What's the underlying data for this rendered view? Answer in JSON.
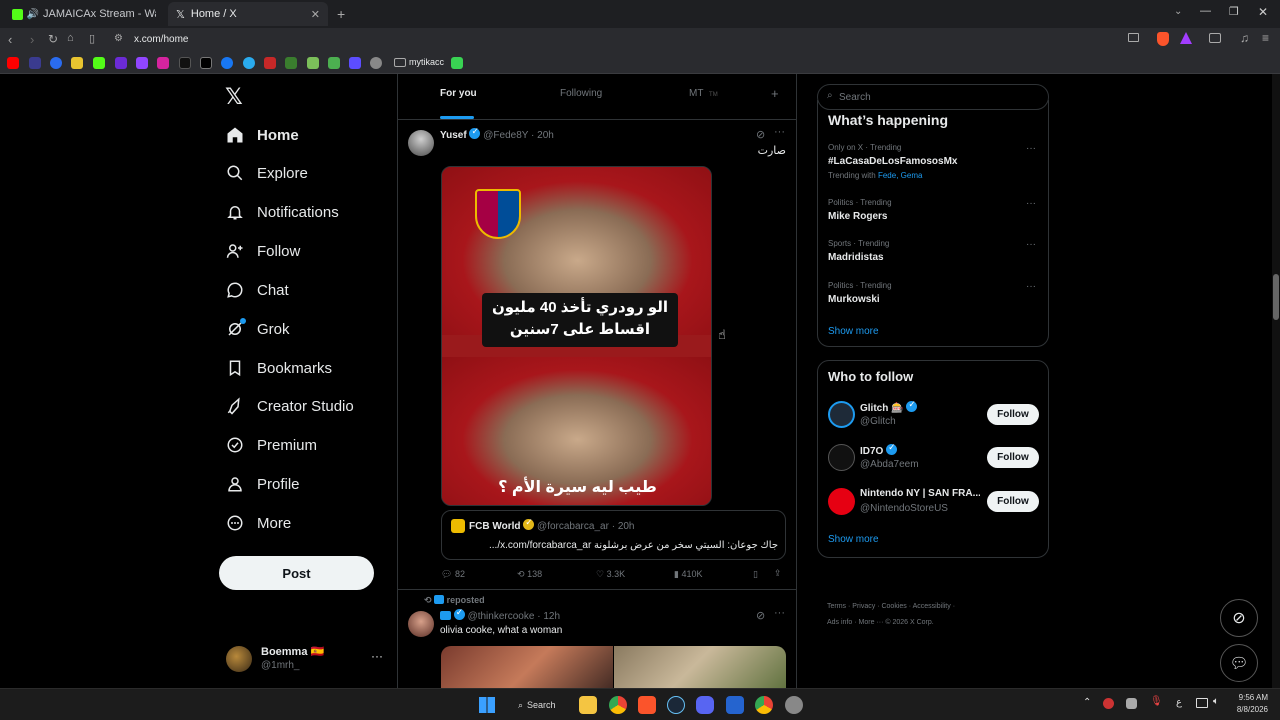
{
  "browser": {
    "tabs": [
      {
        "title": "JAMAICAx Stream - Watch Live o",
        "active": false
      },
      {
        "title": "Home / X",
        "active": true
      }
    ],
    "url": "x.com/home",
    "bookmark_folder": "mytikacc"
  },
  "sidebar": {
    "items": [
      {
        "label": "Home",
        "icon": "home-icon"
      },
      {
        "label": "Explore",
        "icon": "search-icon"
      },
      {
        "label": "Notifications",
        "icon": "bell-icon"
      },
      {
        "label": "Follow",
        "icon": "person-add-icon"
      },
      {
        "label": "Chat",
        "icon": "chat-icon"
      },
      {
        "label": "Grok",
        "icon": "grok-icon"
      },
      {
        "label": "Bookmarks",
        "icon": "bookmark-icon"
      },
      {
        "label": "Creator Studio",
        "icon": "rocket-icon"
      },
      {
        "label": "Premium",
        "icon": "premium-icon"
      },
      {
        "label": "Profile",
        "icon": "profile-icon"
      },
      {
        "label": "More",
        "icon": "more-circle-icon"
      }
    ],
    "post_button": "Post",
    "account": {
      "name": "Boemma 🇪🇸",
      "handle": "@1mrh_"
    }
  },
  "feed": {
    "tabs": [
      {
        "label": "For you",
        "active": true
      },
      {
        "label": "Following",
        "active": false
      },
      {
        "label": "MT",
        "active": false
      }
    ],
    "tab_badge": "TM",
    "post1": {
      "name": "Yusef",
      "handle": "@Fede8Y",
      "time": "20h",
      "text": "صارت",
      "image_text_top_1": "الو رودري تأخذ 40 مليون",
      "image_text_top_2": "اقساط على 7سنين",
      "image_text_bottom": "طيب ليه سيرة الأم ؟",
      "quote": {
        "name": "FCB World",
        "handle": "@forcabarca_ar",
        "time": "20h",
        "text": "جاك جوعان: السيتي سخر من عرض برشلونة x.com/forcabarca_ar/..."
      },
      "stats": {
        "replies": "82",
        "reposts": "138",
        "likes": "3.3K",
        "views": "410K"
      }
    },
    "post2": {
      "reposted_label": "reposted",
      "handle": "@thinkercooke",
      "time": "12h",
      "text": "olivia cooke, what a woman"
    }
  },
  "right": {
    "search_placeholder": "Search",
    "whats_happening": "What’s happening",
    "trends": [
      {
        "meta": "Only on X · Trending",
        "name": "#LaCasaDeLosFamososMx",
        "extra_label": "Trending with",
        "extra_links": "Fede, Gema"
      },
      {
        "meta": "Politics · Trending",
        "name": "Mike Rogers"
      },
      {
        "meta": "Sports · Trending",
        "name": "Madridistas"
      },
      {
        "meta": "Politics · Trending",
        "name": "Murkowski"
      }
    ],
    "show_more": "Show more",
    "who_to_follow": "Who to follow",
    "follow_suggestions": [
      {
        "name": "Glitch 🎰",
        "handle": "@Glitch",
        "button": "Follow",
        "color": "#1d9bf0"
      },
      {
        "name": "ID7O",
        "handle": "@Abda7eem",
        "button": "Follow",
        "color": "#ffffff"
      },
      {
        "name": "Nintendo NY | SAN FRA...",
        "handle": "@NintendoStoreUS",
        "button": "Follow",
        "color": "#e60012"
      }
    ],
    "show_more_2": "Show more",
    "footer": [
      "Terms",
      "Privacy",
      "Cookies",
      "Accessibility",
      "Ads info",
      "More ···",
      "© 2026 X Corp."
    ]
  },
  "taskbar": {
    "search_label": "Search",
    "time": "9:56 AM",
    "date": "8/8/2026",
    "lang": "ع"
  },
  "colors": {
    "accent": "#1d9bf0",
    "bg": "#000000",
    "text": "#e7e9ea",
    "muted": "#71767b"
  }
}
